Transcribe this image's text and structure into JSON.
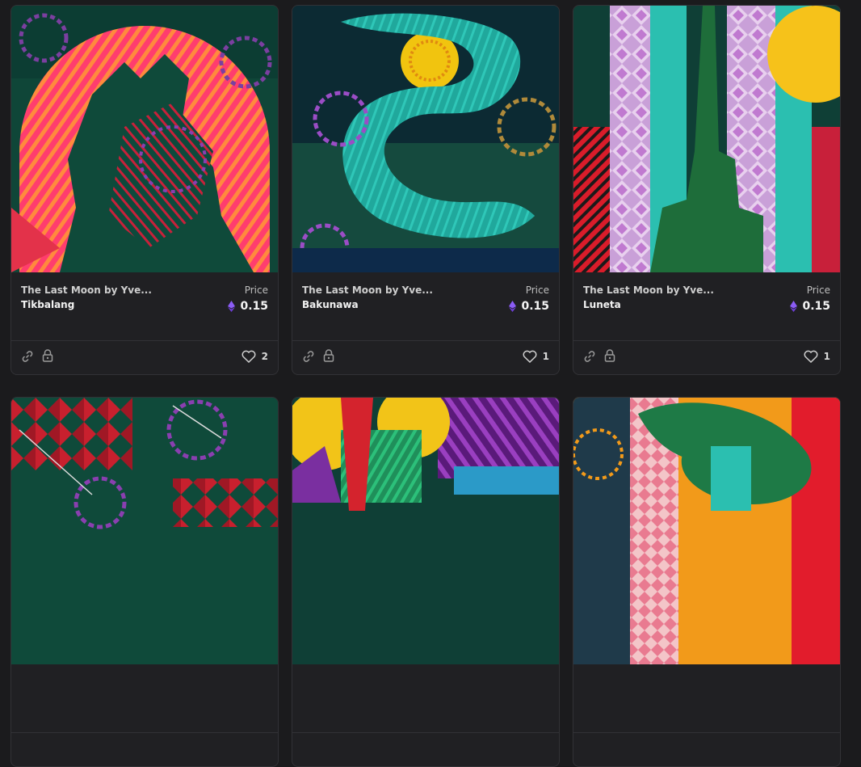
{
  "cards": [
    {
      "collection": "The Last Moon by Yve...",
      "name": "Tikbalang",
      "price_label": "Price",
      "price": "0.15",
      "likes": "2"
    },
    {
      "collection": "The Last Moon by Yve...",
      "name": "Bakunawa",
      "price_label": "Price",
      "price": "0.15",
      "likes": "1"
    },
    {
      "collection": "The Last Moon by Yve...",
      "name": "Luneta",
      "price_label": "Price",
      "price": "0.15",
      "likes": "1"
    },
    {
      "collection": "",
      "name": "",
      "price_label": "",
      "price": "",
      "likes": ""
    },
    {
      "collection": "",
      "name": "",
      "price_label": "",
      "price": "",
      "likes": ""
    },
    {
      "collection": "",
      "name": "",
      "price_label": "",
      "price": "",
      "likes": ""
    }
  ],
  "icons": {
    "currency": "ethereum-icon",
    "link": "link-icon",
    "lock": "lock-icon",
    "like": "heart-icon"
  },
  "colors": {
    "background": "#1b1b1d",
    "card": "#202023",
    "eth_accent": "#8b5cf6"
  }
}
